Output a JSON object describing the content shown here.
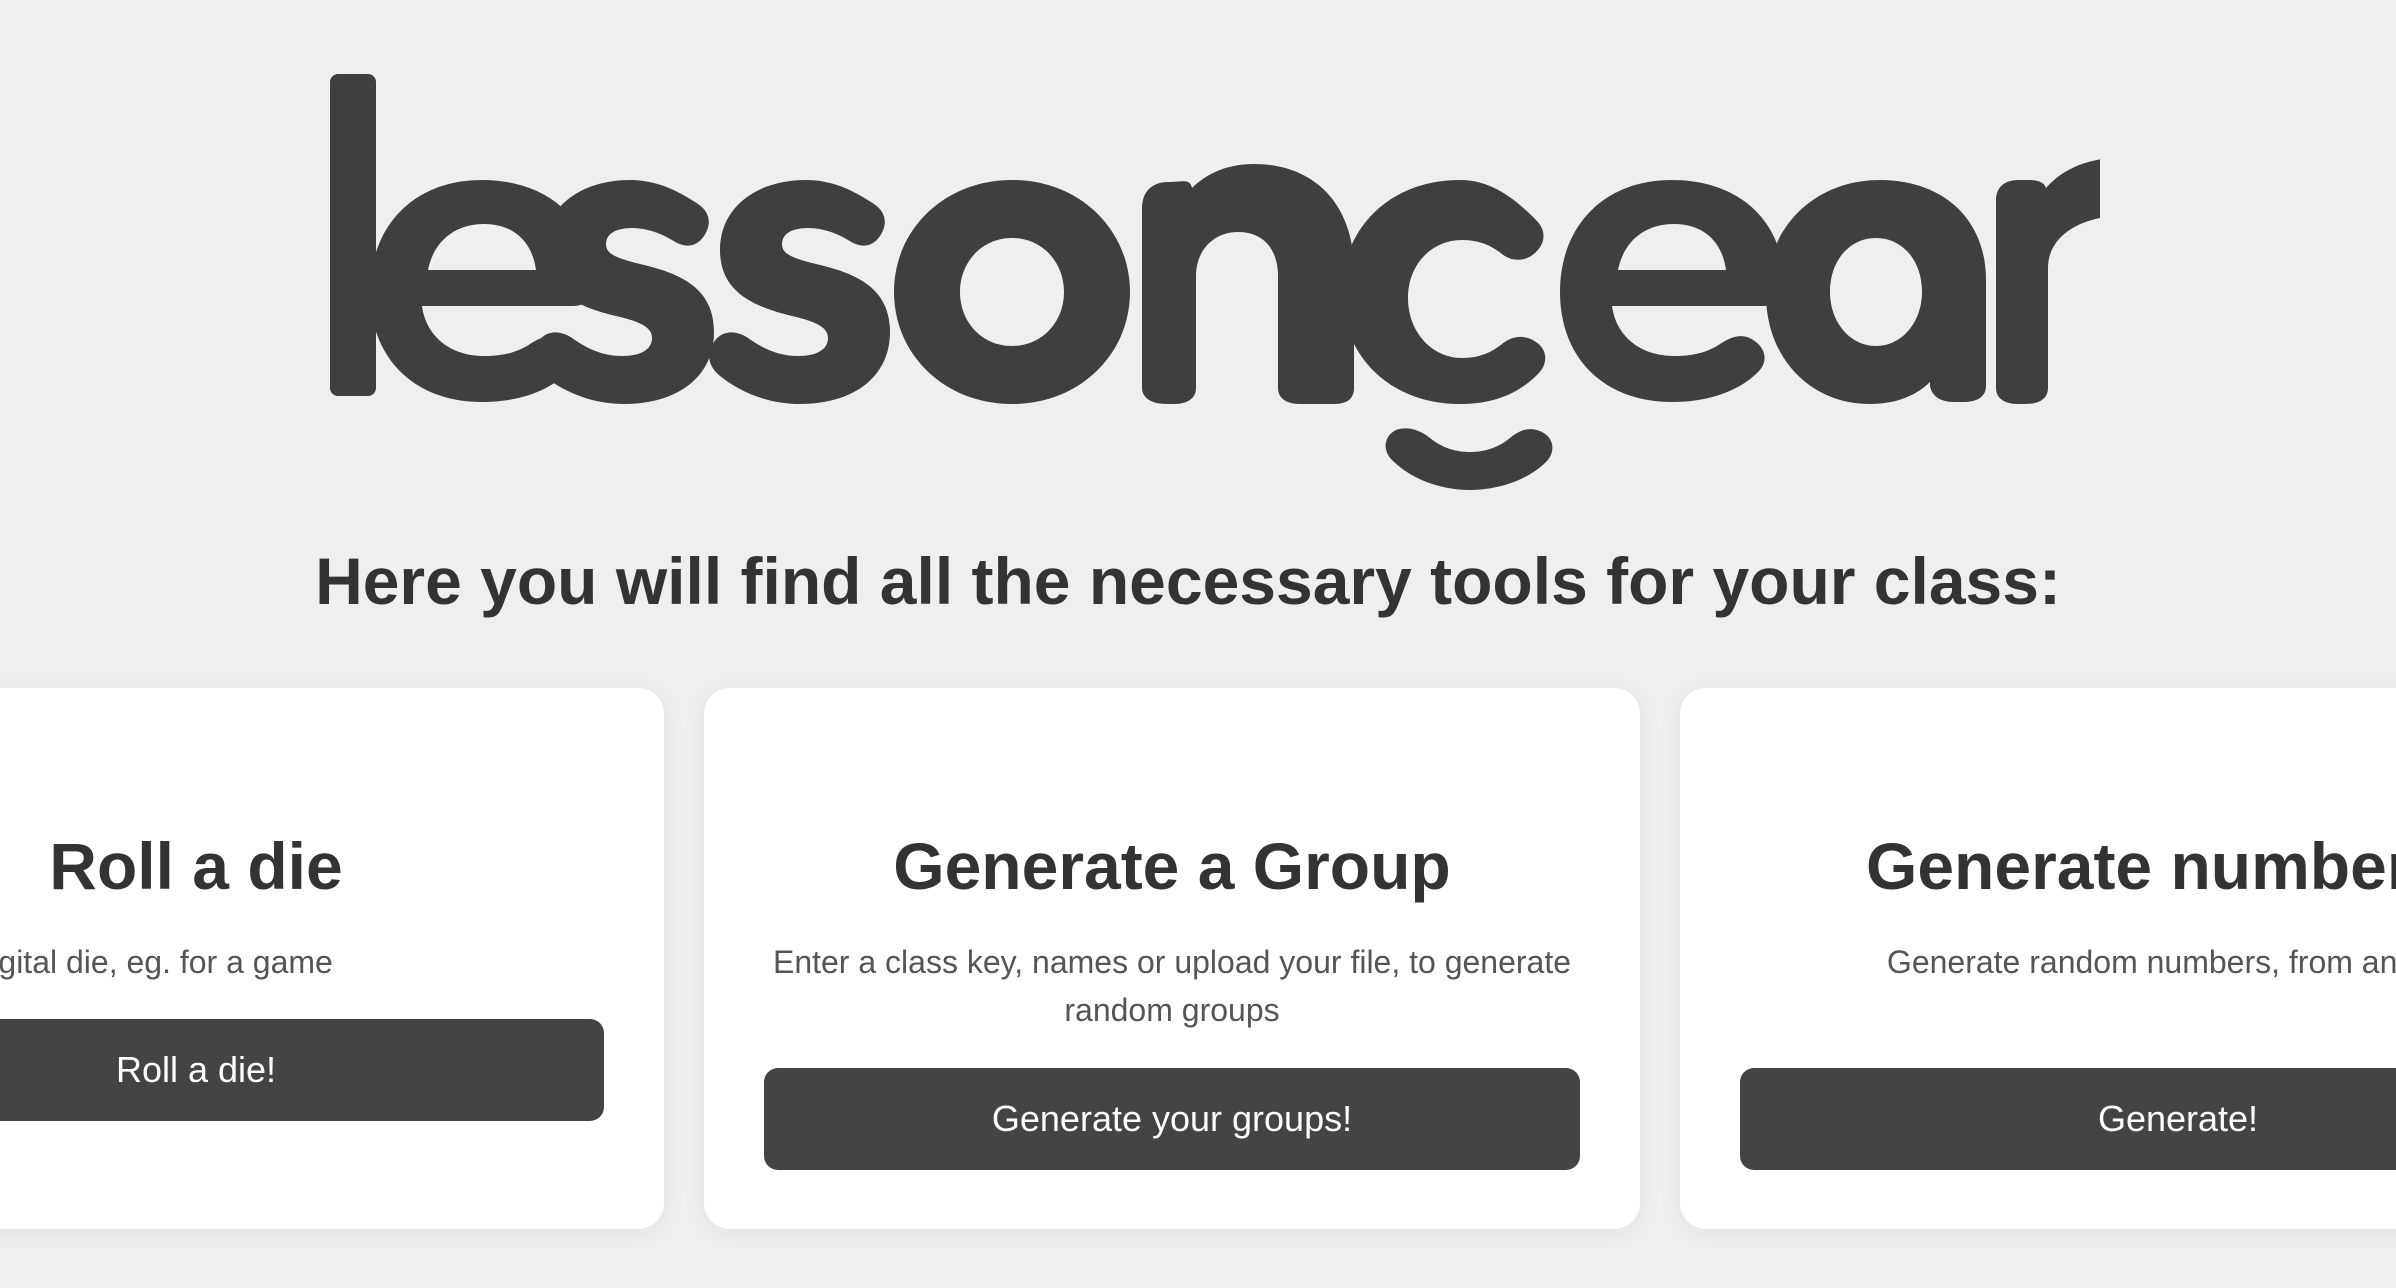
{
  "logo": {
    "text": "lessonçear",
    "color": "#3f3f3f"
  },
  "tagline": "Here you will find all the necessary tools for your class:",
  "cards": [
    {
      "title": "Roll a die",
      "description": "can throw a digital die, eg. for a game",
      "button_label": "Roll a die!"
    },
    {
      "title": "Generate a Group",
      "description": "Enter a class key, names or upload your file, to generate random groups",
      "button_label": "Generate your groups!"
    },
    {
      "title": "Generate number",
      "description": "Generate random numbers, from any numbe other.",
      "button_label": "Generate!"
    }
  ],
  "colors": {
    "background": "#efefef",
    "card": "#ffffff",
    "button": "#444444",
    "text": "#333333"
  }
}
